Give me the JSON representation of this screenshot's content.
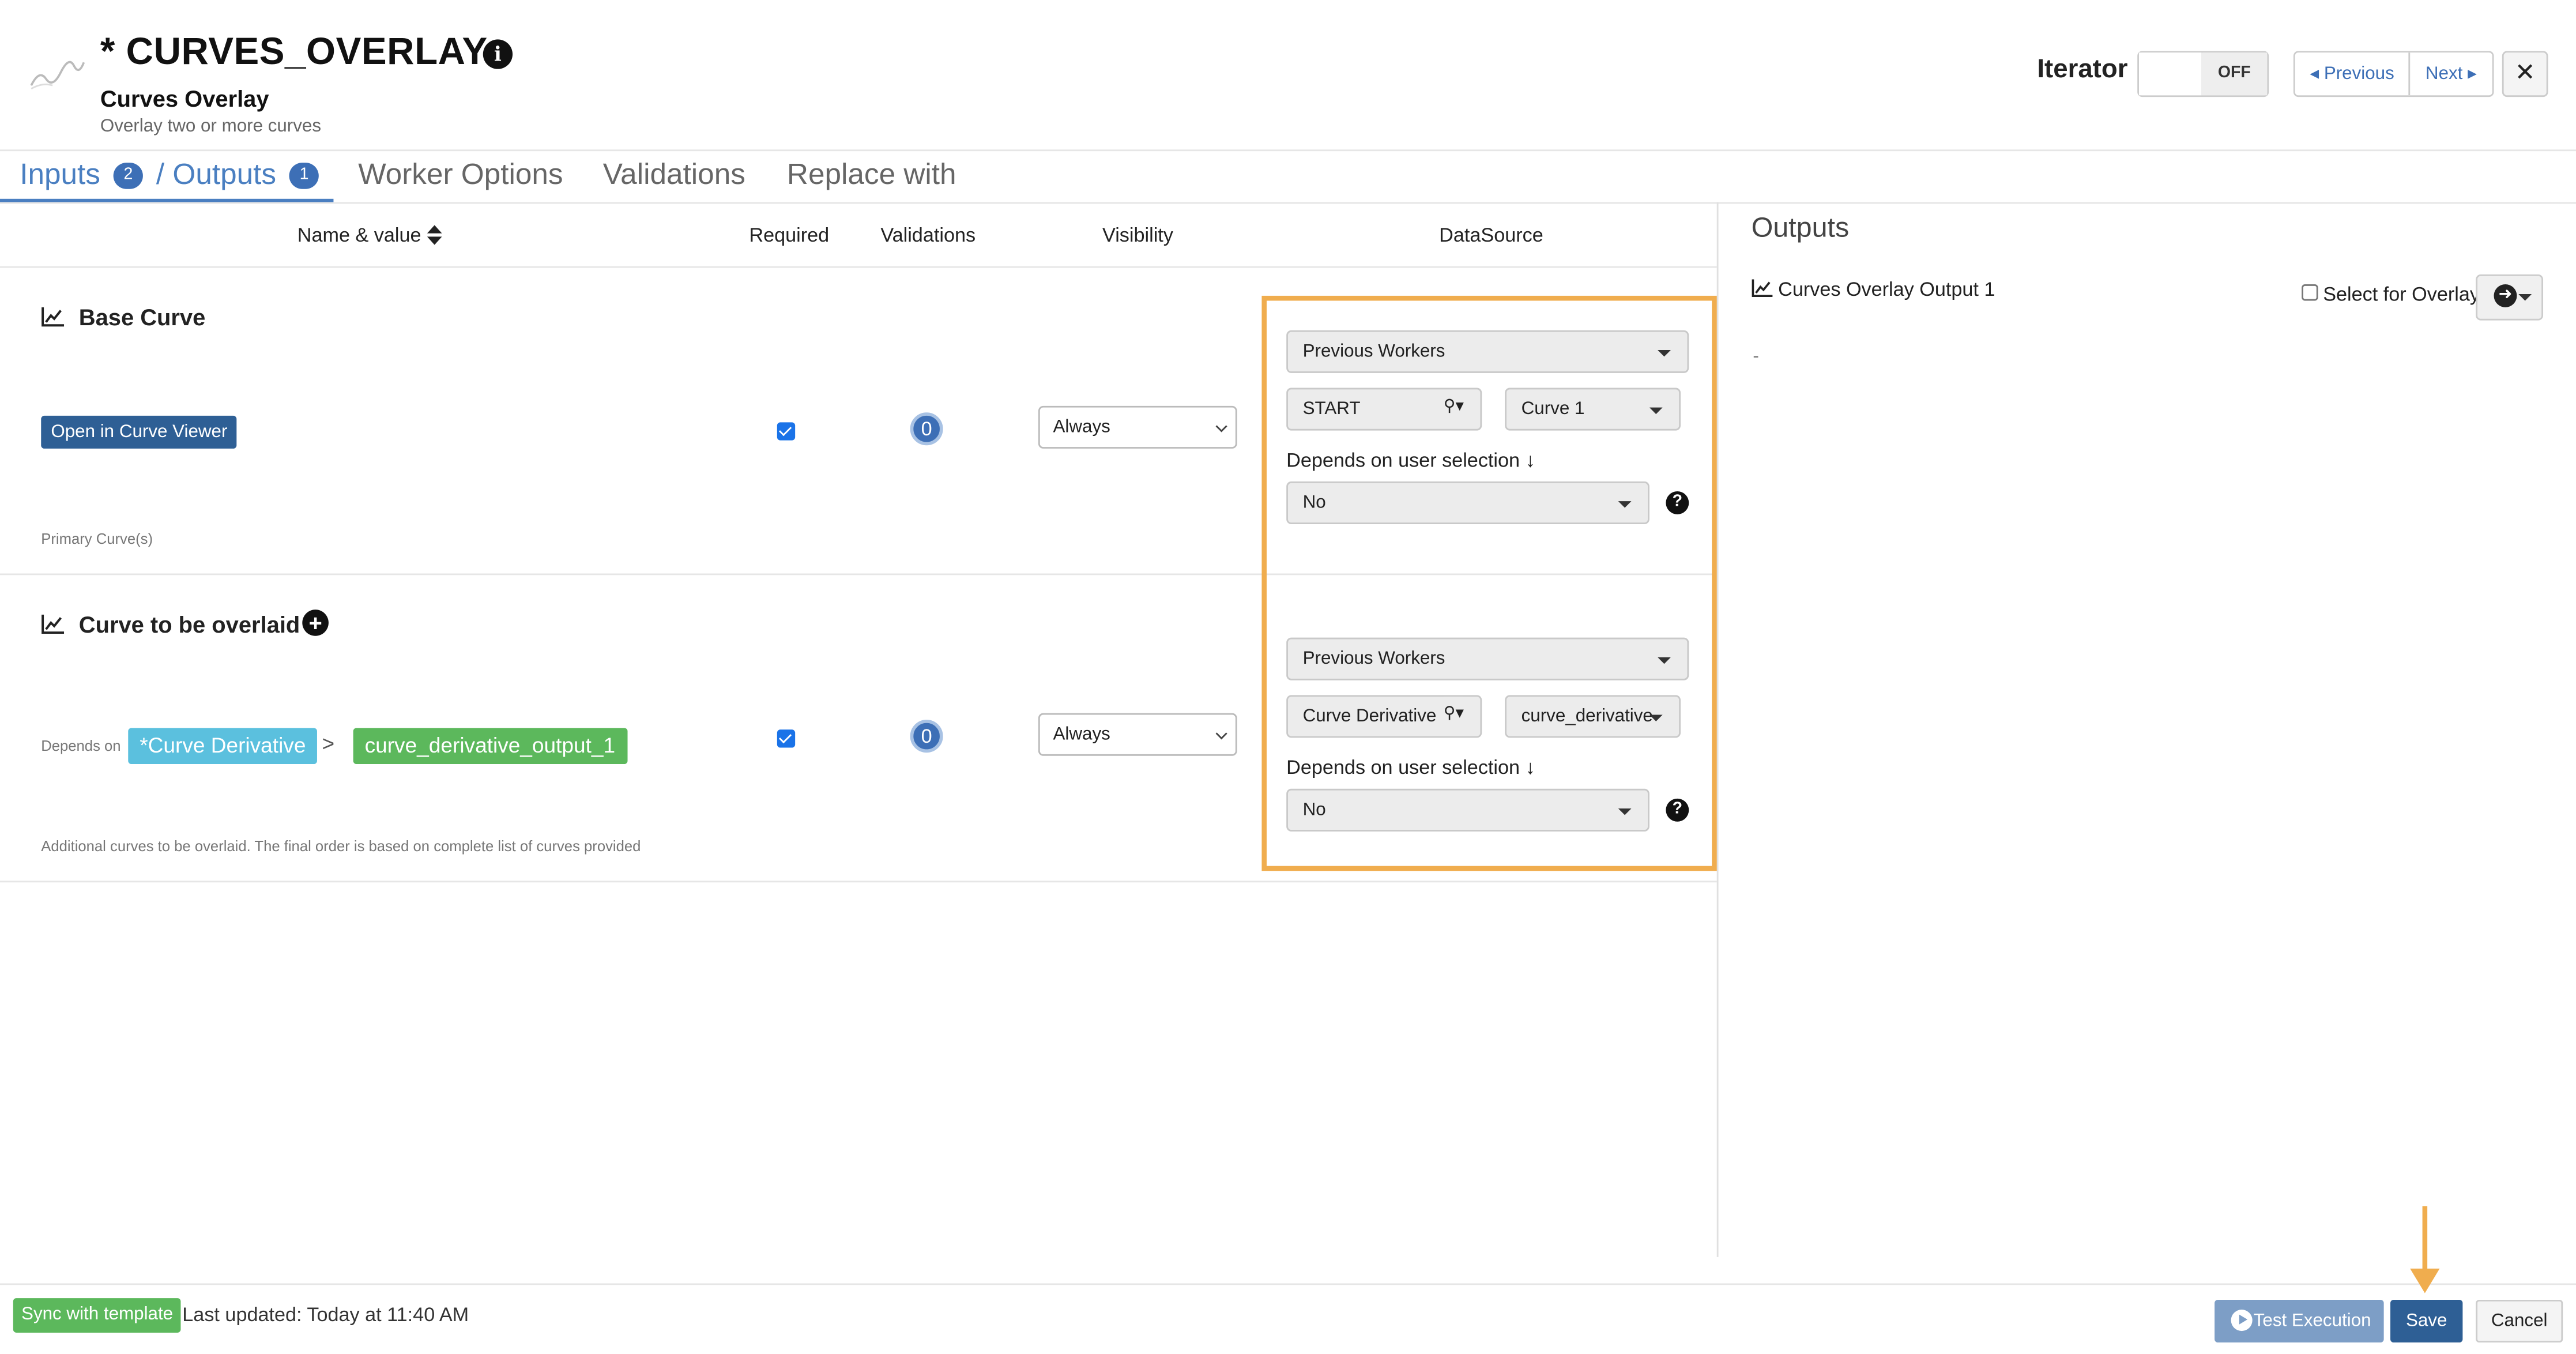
{
  "header": {
    "title": "* CURVES_OVERLAY",
    "subtitle": "Curves Overlay",
    "description": "Overlay two or more curves",
    "info_icon": "info-circle-icon",
    "iterator_label": "Iterator",
    "iterator_state": "OFF",
    "previous_label": "Previous",
    "next_label": "Next",
    "close_label": "✕"
  },
  "tabs": {
    "inputs_label": "Inputs",
    "inputs_count": "2",
    "outputs_label": "/ Outputs",
    "outputs_count": "1",
    "worker_options": "Worker Options",
    "validations": "Validations",
    "replace_with": "Replace with"
  },
  "columns": {
    "name_value": "Name & value",
    "required": "Required",
    "validations": "Validations",
    "visibility": "Visibility",
    "datasource": "DataSource"
  },
  "rows": [
    {
      "title": "Base Curve",
      "action_label": "Open in Curve Viewer",
      "hint": "Primary Curve(s)",
      "required": true,
      "validations_count": "0",
      "visibility": "Always",
      "source_type": "Previous Workers",
      "worker": "START",
      "output": "Curve 1",
      "depends_label": "Depends on user selection",
      "depends_value": "No"
    },
    {
      "title": "Curve to be overlaid",
      "depends_on_label": "Depends on",
      "depends_worker_tag": "*Curve Derivative",
      "depends_output_tag": "curve_derivative_output_1",
      "separator": ">",
      "hint": "Additional curves to be overlaid. The final order is based on complete list of curves provided",
      "required": true,
      "validations_count": "0",
      "visibility": "Always",
      "source_type": "Previous Workers",
      "worker": "Curve Derivative",
      "output": "curve_derivative",
      "depends_label": "Depends on user selection",
      "depends_value": "No"
    }
  ],
  "outputs_panel": {
    "title": "Outputs",
    "item_label": "Curves Overlay Output 1",
    "select_label": "Select for Overlay",
    "placeholder": "-"
  },
  "footer": {
    "sync_label": "Sync with template",
    "last_updated": "Last updated: Today at 11:40 AM",
    "test_label": "Test Execution",
    "save_label": "Save",
    "cancel_label": "Cancel"
  },
  "colors": {
    "accent_blue": "#3d6fb6",
    "highlight_orange": "#f0ad4e",
    "success_green": "#5cb85c",
    "info_blue": "#5bc0de"
  }
}
